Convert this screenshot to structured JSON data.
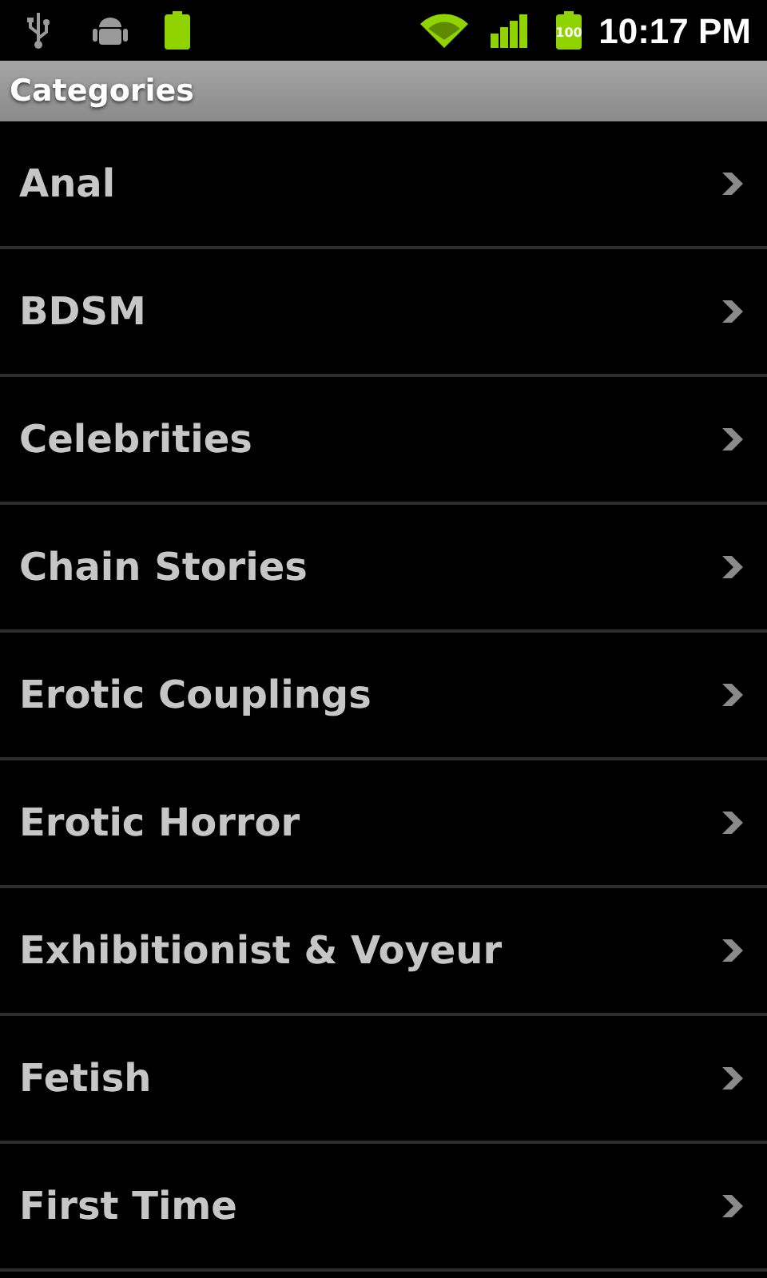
{
  "status_bar": {
    "battery_label": "100",
    "time": "10:17 PM"
  },
  "title": "Categories",
  "categories": [
    {
      "label": "Anal"
    },
    {
      "label": "BDSM"
    },
    {
      "label": "Celebrities"
    },
    {
      "label": "Chain Stories"
    },
    {
      "label": "Erotic Couplings"
    },
    {
      "label": "Erotic Horror"
    },
    {
      "label": "Exhibitionist & Voyeur"
    },
    {
      "label": "Fetish"
    },
    {
      "label": "First Time"
    }
  ]
}
